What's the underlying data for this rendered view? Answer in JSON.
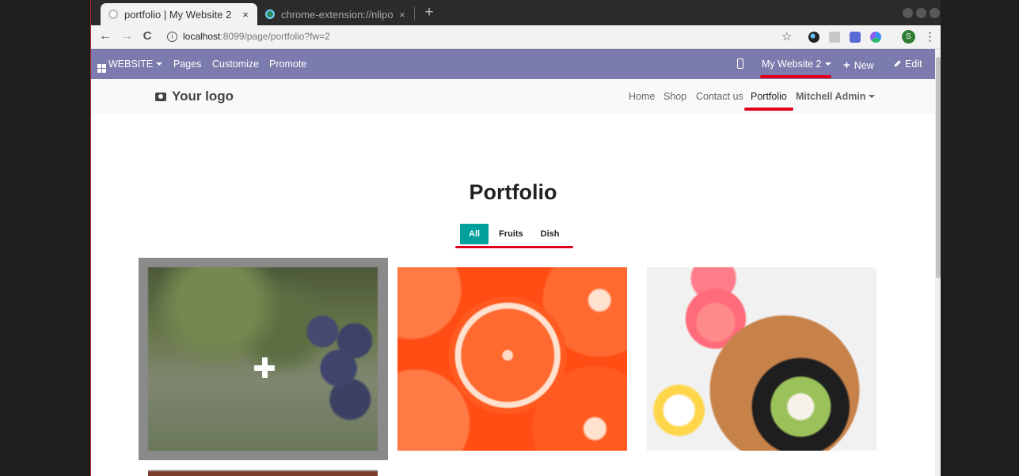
{
  "browser": {
    "tabs": [
      {
        "title": "portfolio | My Website 2",
        "close": "×"
      },
      {
        "title": "chrome-extension://nlipo",
        "close": "×"
      }
    ],
    "new_tab": "+",
    "url_host": "localhost",
    "url_path": ":8099/page/portfolio?fw=2",
    "nav_back": "←",
    "nav_forward": "→",
    "nav_reload": "C",
    "info_icon": "i",
    "star": "☆",
    "profile_initial": "S",
    "menu": "⋮"
  },
  "admin_bar": {
    "website": "WEBSITE",
    "pages": "Pages",
    "customize": "Customize",
    "promote": "Promote",
    "site_switch": "My Website 2",
    "new": "New",
    "new_icon": "+",
    "edit": "Edit"
  },
  "site_header": {
    "logo": "Your logo",
    "nav": [
      "Home",
      "Shop",
      "Contact us",
      "Portfolio"
    ],
    "user": "Mitchell Admin"
  },
  "page": {
    "title": "Portfolio",
    "filters": [
      "All",
      "Fruits",
      "Dish"
    ],
    "active_filter": "All"
  },
  "colors": {
    "admin_bar": "#7c7bad",
    "filter_active": "#00a09d",
    "annotation": "#e0001b"
  }
}
